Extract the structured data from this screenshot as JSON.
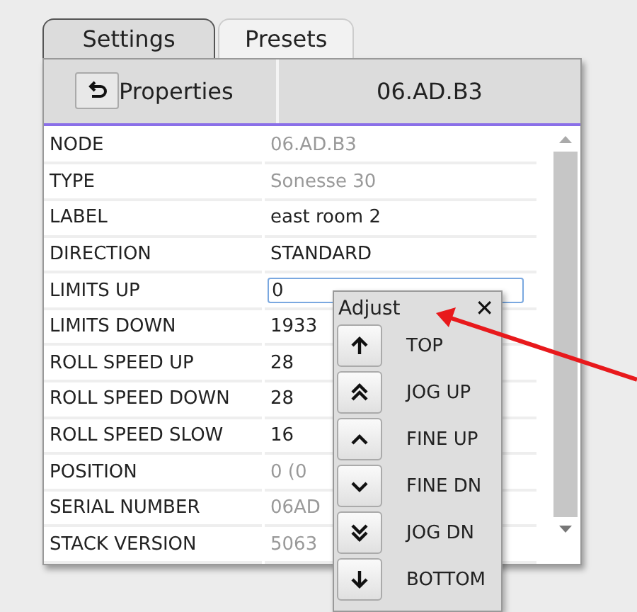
{
  "tabs": [
    {
      "label": "Settings",
      "selected": true
    },
    {
      "label": "Presets",
      "selected": false
    }
  ],
  "header": {
    "title": "Properties",
    "node": "06.AD.B3"
  },
  "rows": [
    {
      "label": "NODE",
      "value": "06.AD.B3",
      "readonly": true,
      "kind": "text"
    },
    {
      "label": "TYPE",
      "value": "Sonesse 30",
      "readonly": true,
      "kind": "text"
    },
    {
      "label": "LABEL",
      "value": "east room 2",
      "readonly": false,
      "kind": "text"
    },
    {
      "label": "DIRECTION",
      "value": "STANDARD",
      "readonly": false,
      "kind": "text"
    },
    {
      "label": "LIMITS UP",
      "value": "0",
      "readonly": false,
      "kind": "input"
    },
    {
      "label": "LIMITS DOWN",
      "value": "1933",
      "readonly": false,
      "kind": "text"
    },
    {
      "label": "ROLL SPEED UP",
      "value": "28",
      "readonly": false,
      "kind": "text"
    },
    {
      "label": "ROLL SPEED DOWN",
      "value": "28",
      "readonly": false,
      "kind": "text"
    },
    {
      "label": "ROLL SPEED SLOW",
      "value": "16",
      "readonly": false,
      "kind": "text"
    },
    {
      "label": "POSITION",
      "value": "0 (0",
      "readonly": true,
      "kind": "text"
    },
    {
      "label": "SERIAL NUMBER",
      "value": "06AD",
      "readonly": true,
      "kind": "text"
    },
    {
      "label": "STACK VERSION",
      "value": "5063",
      "readonly": true,
      "kind": "text"
    }
  ],
  "adjust": {
    "title": "Adjust",
    "close": "✕",
    "actions": [
      {
        "label": "TOP",
        "kind": "arrow_up"
      },
      {
        "label": "JOG UP",
        "kind": "double_up"
      },
      {
        "label": "FINE UP",
        "kind": "chevron_up"
      },
      {
        "label": "FINE DN",
        "kind": "chevron_down"
      },
      {
        "label": "JOG DN",
        "kind": "double_down"
      },
      {
        "label": "BOTTOM",
        "kind": "arrow_down"
      }
    ]
  }
}
